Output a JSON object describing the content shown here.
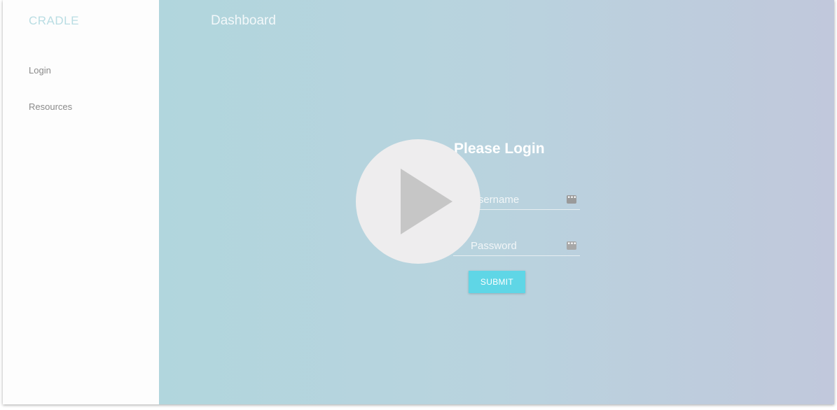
{
  "sidebar": {
    "brand": "CRADLE",
    "items": [
      {
        "label": "Login"
      },
      {
        "label": "Resources"
      }
    ]
  },
  "header": {
    "title": "Dashboard"
  },
  "login_form": {
    "title": "Please Login",
    "username_placeholder": "Username",
    "password_placeholder": "Password",
    "submit_label": "SUBMIT",
    "field_icon": "password-manager-key-icon"
  },
  "overlay": {
    "icon": "play-icon"
  },
  "colors": {
    "brand": "#b9dde3",
    "submit": "#5fd6e6",
    "gradient_start": "#b1d6dd",
    "gradient_end": "#c1c8dc",
    "play_circle": "#eeedee",
    "play_triangle": "#c6c6c6"
  }
}
